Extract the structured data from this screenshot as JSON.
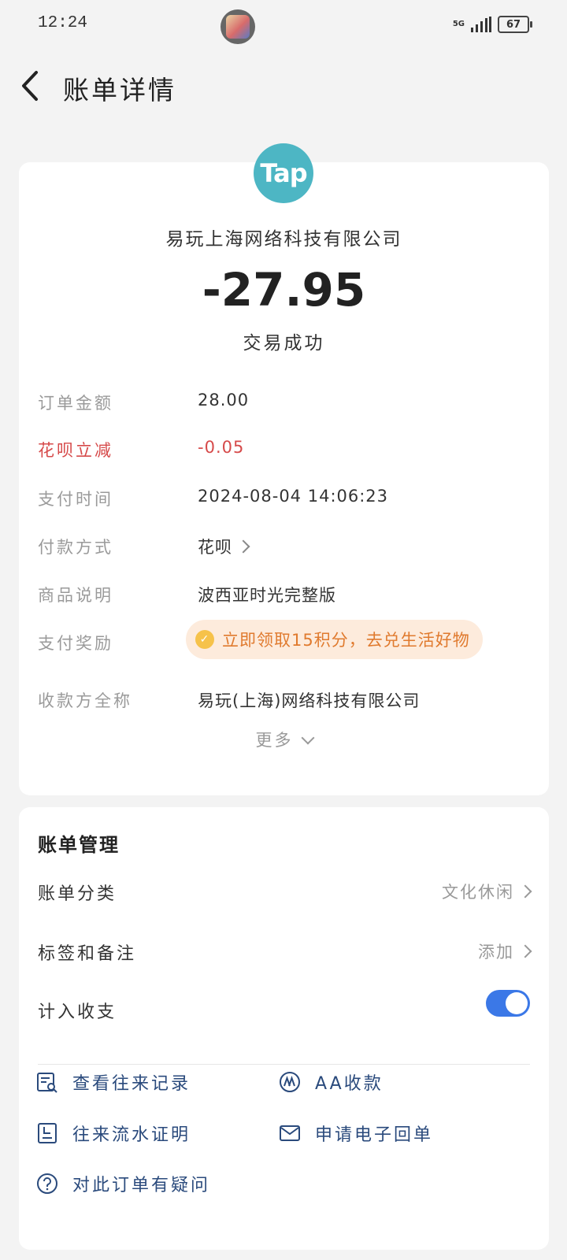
{
  "status_bar": {
    "time": "12:24",
    "network": "5G",
    "battery": "67"
  },
  "header": {
    "title": "账单详情",
    "back_icon": "chevron-left-icon"
  },
  "detail": {
    "merchant_logo_text": "Tap",
    "merchant_name": "易玩上海网络科技有限公司",
    "amount": "-27.95",
    "status": "交易成功",
    "rows": [
      {
        "label": "订单金额",
        "value": "28.00"
      },
      {
        "label": "花呗立减",
        "value": "-0.05",
        "highlight_color": "#d64a4a"
      },
      {
        "label": "支付时间",
        "value": "2024-08-04 14:06:23"
      },
      {
        "label": "付款方式",
        "value": "花呗"
      },
      {
        "label": "商品说明",
        "value": "波西亚时光完整版"
      },
      {
        "label": "支付奖励",
        "value": "立即领取15积分，去兑生活好物"
      },
      {
        "label": "收款方全称",
        "value": "易玩(上海)网络科技有限公司"
      }
    ],
    "more_label": "更多"
  },
  "manage": {
    "title": "账单管理",
    "category": {
      "label": "账单分类",
      "value": "文化休闲"
    },
    "tags": {
      "label": "标签和备注",
      "value": "添加"
    },
    "income_expense": {
      "label": "计入收支",
      "enabled": true
    },
    "actions": [
      {
        "label": "查看往来记录",
        "icon": "records-search-icon"
      },
      {
        "label": "AA收款",
        "icon": "aa-icon"
      },
      {
        "label": "往来流水证明",
        "icon": "document-icon"
      },
      {
        "label": "申请电子回单",
        "icon": "mail-icon"
      },
      {
        "label": "对此订单有疑问",
        "icon": "question-icon"
      }
    ]
  },
  "colors": {
    "accent_blue": "#3b78e7",
    "reward_orange": "#e07a2e",
    "action_text": "#2a4a7c",
    "logo_teal": "#4db6c4"
  }
}
